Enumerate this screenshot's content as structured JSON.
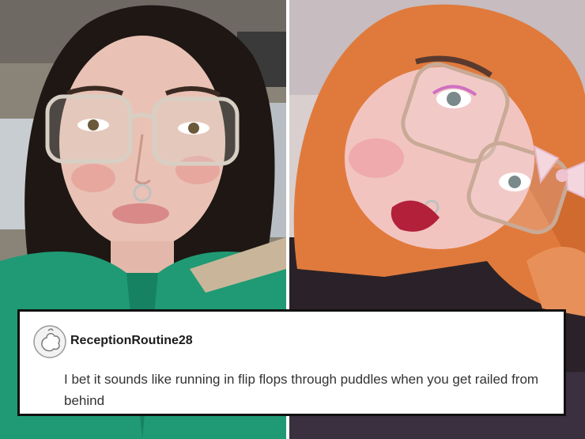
{
  "photos": {
    "left": {
      "subject": "person with dark bob hair and clear-frame glasses in green jacket"
    },
    "right": {
      "subject": "person with orange hair, glasses and pink bow"
    }
  },
  "comment": {
    "username": "ReceptionRoutine28",
    "text": "I bet it sounds like running in flip flops through puddles when you get railed from behind",
    "avatar_icon": "default-avatar-icon"
  },
  "colors": {
    "card_background": "#ffffff",
    "card_border": "#111111",
    "text": "#333333"
  }
}
